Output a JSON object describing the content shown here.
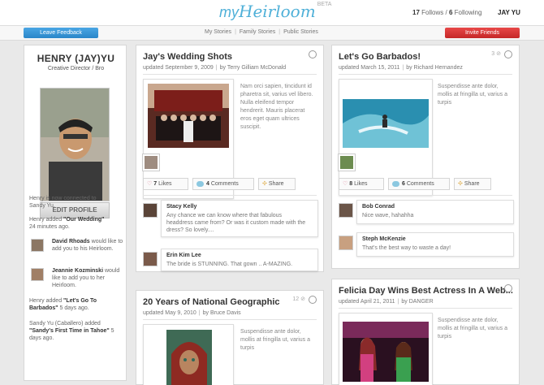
{
  "header": {
    "logo_my": "my",
    "logo_heirloom": "Heirloom",
    "logo_beta": "BETA",
    "follows_count": "17",
    "follows_label": "Follows",
    "following_count": "6",
    "following_label": "Following",
    "user_name": "JAY YU"
  },
  "subnav": {
    "feedback_label": "Leave Feedback",
    "items": [
      "My Stories",
      "Family Stories",
      "Public Stories"
    ],
    "invite_label": "Invite Friends"
  },
  "profile": {
    "name": "HENRY (JAY)YU",
    "title": "Creative Director / Bro",
    "edit_label": "EDIT PROFILE",
    "activity": [
      {
        "pre": "Henry is now connected to",
        "bold": "",
        "post": "Sandy Yu."
      },
      {
        "pre": "Henry added ",
        "bold": "\"Our Wedding\"",
        "post": "24 minutes ago."
      },
      {
        "pre": "",
        "bold": "David Rhoads",
        "post": " would like to add you to his Heirloom."
      },
      {
        "pre": "",
        "bold": "Jeannie Kozminski",
        "post": " would like to add you to her Heirloom."
      },
      {
        "pre": "Henry added ",
        "bold": "\"Let's Go To Barbados\"",
        "post": " 5 days ago."
      },
      {
        "pre": "Sandy Yu (Caballero) added ",
        "bold": "\"Sandy's First Time in Tahoe\"",
        "post": " 5 days ago."
      }
    ]
  },
  "cards": {
    "wedding": {
      "title": "Jay's Wedding Shots",
      "updated": "updated September 9, 2009",
      "by": "by Terry Gilliam McDonald",
      "desc": "Nam orci sapien, tincidunt id pharetra sit, varius vel libero. Nulla eleifend tempor hendrerit. Mauris placerat eros eget quam ultrices suscipit.",
      "likes_count": "7",
      "likes_label": "Likes",
      "comments_count": "4",
      "comments_label": "Comments",
      "share_label": "Share",
      "comments": [
        {
          "name": "Stacy Kelly",
          "text": "Any chance we can know where that fabulous headdress came from? Or was it custom made with the dress? So lovely...."
        },
        {
          "name": "Erin Kim Lee",
          "text": "The bride is STUNNING. That gown .. A-MAZING."
        }
      ]
    },
    "barbados": {
      "title": "Let's Go Barbados!",
      "count": "3",
      "updated": "updated March 15, 2011",
      "by": "by Richard Hernandez",
      "desc": "Suspendisse ante dolor, mollis at fringilla ut, varius a turpis",
      "likes_count": "8",
      "likes_label": "Likes",
      "comments_count": "6",
      "comments_label": "Comments",
      "share_label": "Share",
      "comments": [
        {
          "name": "Bob Conrad",
          "text": "Nice wave, hahahha"
        },
        {
          "name": "Steph McKenzie",
          "text": "That's the best way to waste a day!"
        }
      ]
    },
    "natgeo": {
      "title": "20 Years of National Geographic",
      "count": "12",
      "updated": "updated May 9, 2010",
      "by": "by Bruce Davis",
      "desc": "Suspendisse ante dolor, mollis at fringilla ut, varius a turpis"
    },
    "felicia": {
      "title": "Felicia Day Wins Best Actress In A Web...",
      "updated": "updated April 21, 2011",
      "by": "by DANGER",
      "desc": "Suspendisse ante dolor, mollis at fringilla ut, varius a turpis"
    }
  }
}
